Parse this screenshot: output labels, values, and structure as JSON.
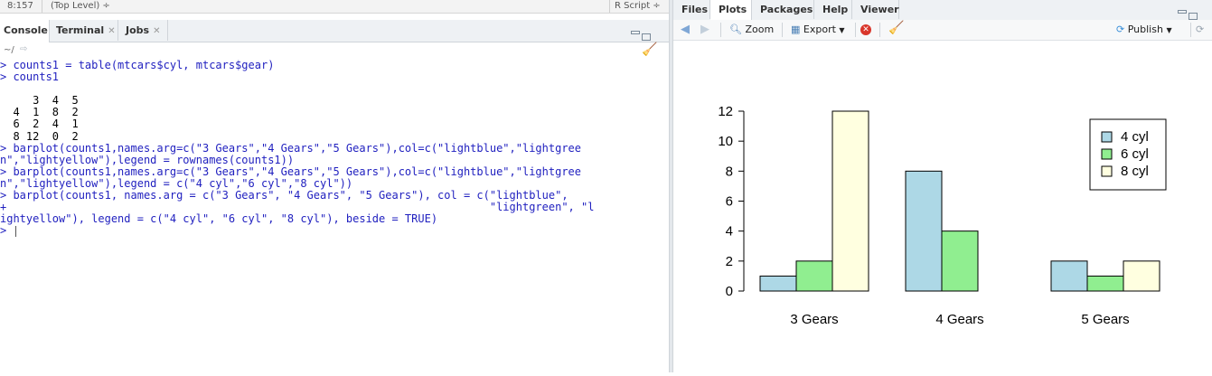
{
  "status": {
    "position": "8:157",
    "scope": "(Top Level) ÷",
    "script_type": "R Script ÷"
  },
  "left_tabs": [
    {
      "label": "Console",
      "closable": false
    },
    {
      "label": "Terminal",
      "closable": true
    },
    {
      "label": "Jobs",
      "closable": true
    }
  ],
  "console_path": "~/",
  "console_lines": [
    {
      "text": "> counts1 = table(mtcars$cyl, mtcars$gear)",
      "kind": "cmd"
    },
    {
      "text": "> counts1",
      "kind": "cmd"
    },
    {
      "text": "",
      "kind": "out"
    },
    {
      "text": "     3  4  5",
      "kind": "out"
    },
    {
      "text": "  4  1  8  2",
      "kind": "out"
    },
    {
      "text": "  6  2  4  1",
      "kind": "out"
    },
    {
      "text": "  8 12  0  2",
      "kind": "out"
    },
    {
      "text": "> barplot(counts1,names.arg=c(\"3 Gears\",\"4 Gears\",\"5 Gears\"),col=c(\"lightblue\",\"lightgree",
      "kind": "cmd"
    },
    {
      "text": "n\",\"lightyellow\"),legend = rownames(counts1))",
      "kind": "cmd"
    },
    {
      "text": "> barplot(counts1,names.arg=c(\"3 Gears\",\"4 Gears\",\"5 Gears\"),col=c(\"lightblue\",\"lightgree",
      "kind": "cmd"
    },
    {
      "text": "n\",\"lightyellow\"),legend = c(\"4 cyl\",\"6 cyl\",\"8 cyl\"))",
      "kind": "cmd"
    },
    {
      "text": "> barplot(counts1, names.arg = c(\"3 Gears\", \"4 Gears\", \"5 Gears\"), col = c(\"lightblue\",",
      "kind": "cmd"
    },
    {
      "text": "+                                                                          \"lightgreen\", \"l",
      "kind": "cmd"
    },
    {
      "text": "ightyellow\"), legend = c(\"4 cyl\", \"6 cyl\", \"8 cyl\"), beside = TRUE)",
      "kind": "cmd"
    },
    {
      "text": "> ",
      "kind": "cmd"
    }
  ],
  "right_tabs": [
    {
      "label": "Files"
    },
    {
      "label": "Plots"
    },
    {
      "label": "Packages"
    },
    {
      "label": "Help"
    },
    {
      "label": "Viewer"
    }
  ],
  "toolbar": {
    "zoom": "Zoom",
    "export": "Export",
    "publish": "Publish"
  },
  "colors": {
    "lightblue": "#add8e6",
    "lightgreen": "#90ee90",
    "lightyellow": "#ffffe0",
    "cmd": "#1f1fbf"
  },
  "chart_data": {
    "type": "bar",
    "categories": [
      "3 Gears",
      "4 Gears",
      "5 Gears"
    ],
    "series": [
      {
        "name": "4 cyl",
        "values": [
          1,
          8,
          2
        ],
        "color": "#add8e6"
      },
      {
        "name": "6 cyl",
        "values": [
          2,
          4,
          1
        ],
        "color": "#90ee90"
      },
      {
        "name": "8 cyl",
        "values": [
          12,
          0,
          2
        ],
        "color": "#ffffe0"
      }
    ],
    "yticks": [
      0,
      2,
      4,
      6,
      8,
      10,
      12
    ],
    "ylim": [
      0,
      12
    ],
    "grouped": true,
    "legend_position": "top-right"
  }
}
